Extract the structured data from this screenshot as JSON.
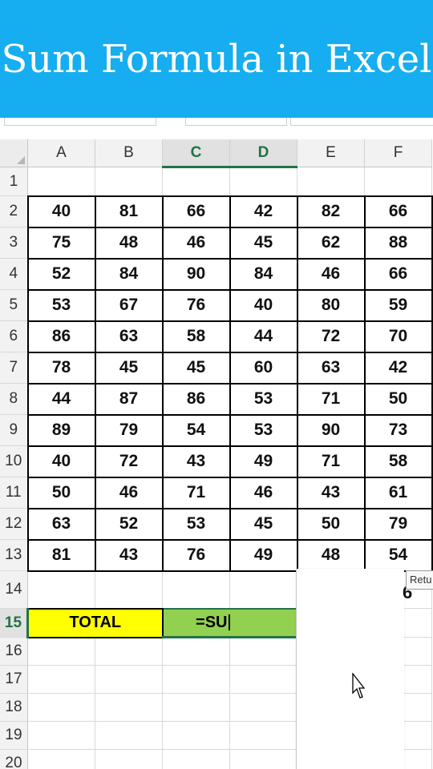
{
  "banner": {
    "title": "Sum Formula in Excel"
  },
  "sheet": {
    "columns": [
      "A",
      "B",
      "C",
      "D",
      "E",
      "F"
    ],
    "selected_columns": [
      "C",
      "D"
    ],
    "rows": [
      "1",
      "2",
      "3",
      "4",
      "5",
      "6",
      "7",
      "8",
      "9",
      "10",
      "11",
      "12",
      "13",
      "14",
      "15",
      "16",
      "17",
      "18",
      "19",
      "20"
    ],
    "selected_row": "15",
    "data": [
      [
        "40",
        "81",
        "66",
        "42",
        "82",
        "66"
      ],
      [
        "75",
        "48",
        "46",
        "45",
        "62",
        "88"
      ],
      [
        "52",
        "84",
        "90",
        "84",
        "46",
        "66"
      ],
      [
        "53",
        "67",
        "76",
        "40",
        "80",
        "59"
      ],
      [
        "86",
        "63",
        "58",
        "44",
        "72",
        "70"
      ],
      [
        "78",
        "45",
        "45",
        "60",
        "63",
        "42"
      ],
      [
        "44",
        "87",
        "86",
        "53",
        "71",
        "50"
      ],
      [
        "89",
        "79",
        "54",
        "53",
        "90",
        "73"
      ],
      [
        "40",
        "72",
        "43",
        "49",
        "71",
        "58"
      ],
      [
        "50",
        "46",
        "71",
        "46",
        "43",
        "61"
      ],
      [
        "63",
        "52",
        "53",
        "45",
        "50",
        "79"
      ],
      [
        "81",
        "43",
        "76",
        "49",
        "48",
        "54"
      ]
    ],
    "total_label": "TOTAL",
    "formula_input": "=SU"
  },
  "autocomplete": {
    "tooltip_text": "Retu",
    "partial_digit": "6"
  },
  "colors": {
    "banner": "#16aef0",
    "total_fill": "#ffff00",
    "formula_fill": "#92d050",
    "selection": "#217346"
  }
}
